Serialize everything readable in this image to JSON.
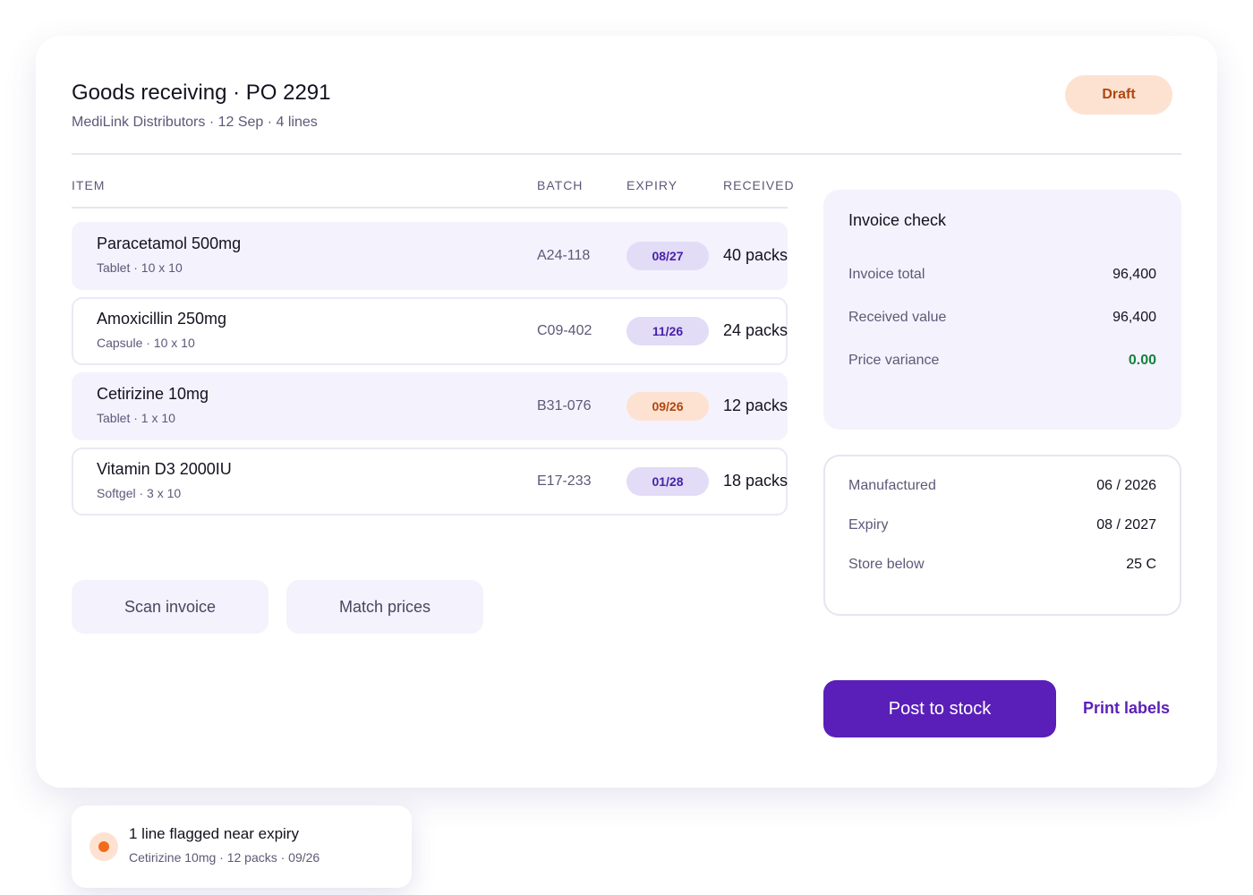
{
  "header": {
    "title": "Goods receiving · PO 2291",
    "subtitle": "MediLink Distributors · 12 Sep · 4 lines",
    "status": "Draft"
  },
  "table": {
    "columns": [
      "ITEM",
      "BATCH",
      "EXPIRY",
      "RECEIVED"
    ],
    "rows": [
      {
        "name": "Paracetamol 500mg",
        "desc": "Tablet · 10 x 10",
        "batch": "A24-118",
        "expiry": "08/27",
        "received": "40 packs"
      },
      {
        "name": "Amoxicillin 250mg",
        "desc": "Capsule · 10 x 10",
        "batch": "C09-402",
        "expiry": "11/26",
        "received": "24 packs"
      },
      {
        "name": "Cetirizine 10mg",
        "desc": "Tablet · 1 x 10",
        "batch": "B31-076",
        "expiry": "09/26",
        "received": "12 packs"
      },
      {
        "name": "Vitamin D3 2000IU",
        "desc": "Softgel · 3 x 10",
        "batch": "E17-233",
        "expiry": "01/28",
        "received": "18 packs"
      }
    ]
  },
  "actions": {
    "scan_invoice": "Scan invoice",
    "match_prices": "Match prices",
    "post_to_stock": "Post to stock",
    "print_labels": "Print labels"
  },
  "invoice_check": {
    "title": "Invoice check",
    "items": [
      {
        "label": "Invoice total",
        "value": "96,400"
      },
      {
        "label": "Received value",
        "value": "96,400"
      },
      {
        "label": "Price variance",
        "value": "0.00"
      }
    ]
  },
  "batch_details": {
    "items": [
      {
        "label": "Manufactured",
        "value": "06 / 2026"
      },
      {
        "label": "Expiry",
        "value": "08 / 2027"
      },
      {
        "label": "Store below",
        "value": "25 C"
      }
    ]
  },
  "toast": {
    "title": "1 line flagged near expiry",
    "subtitle": "Cetirizine 10mg · 12 packs · 09/26"
  },
  "colors": {
    "accent": "#5a1fb8",
    "warning": "#f26a1b",
    "success": "#14823f",
    "draft_bg": "#fde2d2"
  }
}
